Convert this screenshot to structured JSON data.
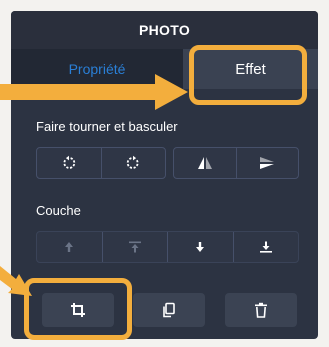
{
  "panel": {
    "title": "PHOTO",
    "tabs": {
      "propriete": "Propriété",
      "effet": "Effet"
    },
    "sections": {
      "rotate_flip": "Faire tourner et basculer",
      "layer": "Couche"
    }
  },
  "icons": {
    "rotate_left": "rotate-counterclockwise-icon",
    "rotate_right": "rotate-clockwise-icon",
    "flip_horizontal": "flip-horizontal-icon",
    "flip_vertical": "flip-vertical-icon",
    "bring_forward": "bring-forward-icon",
    "bring_to_front": "bring-to-front-icon",
    "send_backward": "send-backward-icon",
    "send_to_back": "send-to-back-icon",
    "crop": "crop-icon",
    "duplicate": "duplicate-icon",
    "delete": "trash-icon"
  },
  "colors": {
    "panel_bg": "#2c3342",
    "header_bg": "#2a2f3c",
    "active_tab_bg": "#3a4252",
    "inactive_tab_text": "#2a7fd6",
    "annotation": "#f3ae3d"
  }
}
